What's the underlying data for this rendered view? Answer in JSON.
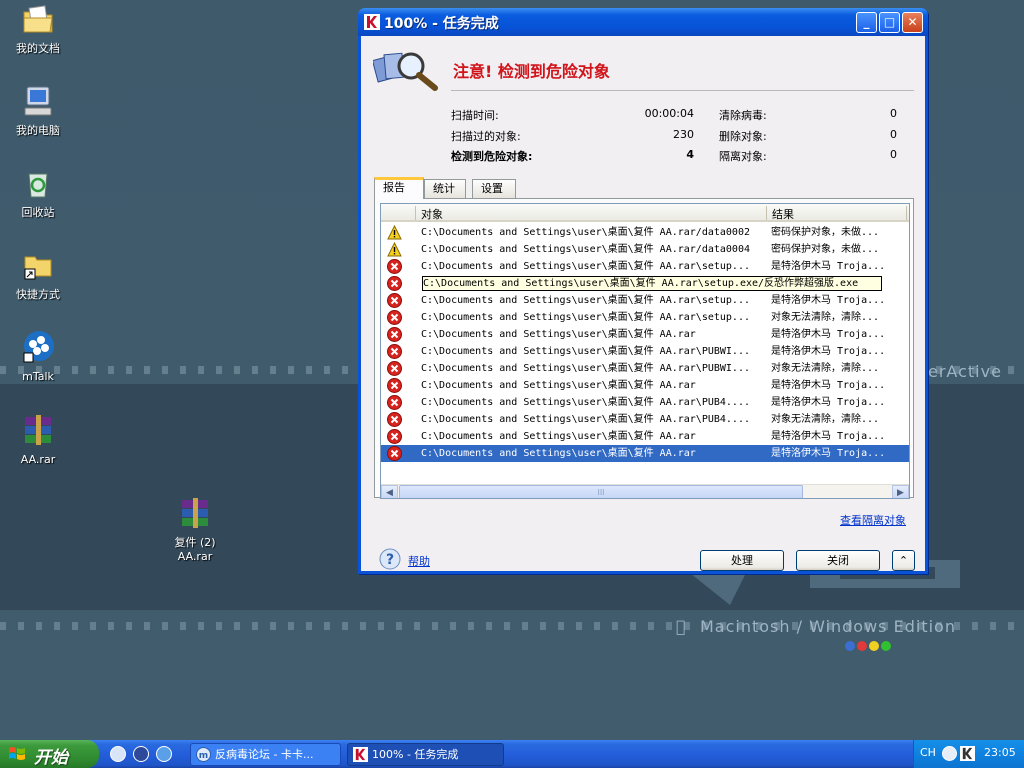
{
  "desktop": {
    "icons": [
      {
        "label": "我的文档"
      },
      {
        "label": "我的电脑"
      },
      {
        "label": "回收站"
      },
      {
        "label": "快捷方式"
      },
      {
        "label": "mTalk"
      },
      {
        "label": "AA.rar"
      },
      {
        "label": "复件 (2)",
        "label2": "AA.rar"
      }
    ],
    "wallpaper_text": "Macintosh / Windows Edition",
    "wallpaper_text2": "erActive"
  },
  "window": {
    "title": "100% - 任务完成",
    "minimize": "_",
    "maximize": "□",
    "close": "✕",
    "alert_title": "注意! 检测到危险对象",
    "stats": {
      "scan_time_label": "扫描时间:",
      "scan_time": "00:00:04",
      "scanned_label": "扫描过的对象:",
      "scanned": "230",
      "detected_label": "检测到危险对象:",
      "detected": "4",
      "disinfected_label": "清除病毒:",
      "disinfected": "0",
      "deleted_label": "删除对象:",
      "deleted": "0",
      "quarantined_label": "隔离对象:",
      "quarantined": "0"
    },
    "tabs": [
      {
        "label": "报告",
        "active": true
      },
      {
        "label": "统计",
        "active": false
      },
      {
        "label": "设置",
        "active": false
      }
    ],
    "columns": {
      "object": "对象",
      "result": "结果"
    },
    "rows": [
      {
        "icon": "warning",
        "object": "C:\\Documents and Settings\\user\\桌面\\复件 AA.rar/data0002",
        "result": "密码保护对象，未做..."
      },
      {
        "icon": "warning",
        "object": "C:\\Documents and Settings\\user\\桌面\\复件 AA.rar/data0004",
        "result": "密码保护对象，未做..."
      },
      {
        "icon": "danger",
        "object": "C:\\Documents and Settings\\user\\桌面\\复件 AA.rar\\setup...",
        "result": "是特洛伊木马 Troja..."
      },
      {
        "icon": "danger",
        "object": "C:\\Documents and Settings\\user\\桌面\\复件 AA.rar\\setup.exe/反恐作弊超强版.exe",
        "result": "...",
        "focus": true
      },
      {
        "icon": "danger",
        "object": "C:\\Documents and Settings\\user\\桌面\\复件 AA.rar\\setup...",
        "result": "是特洛伊木马 Troja..."
      },
      {
        "icon": "danger",
        "object": "C:\\Documents and Settings\\user\\桌面\\复件 AA.rar\\setup...",
        "result": "对象无法清除，清除..."
      },
      {
        "icon": "danger",
        "object": "C:\\Documents and Settings\\user\\桌面\\复件 AA.rar",
        "result": "是特洛伊木马 Troja..."
      },
      {
        "icon": "danger",
        "object": "C:\\Documents and Settings\\user\\桌面\\复件 AA.rar\\PUBWI...",
        "result": "是特洛伊木马 Troja..."
      },
      {
        "icon": "danger",
        "object": "C:\\Documents and Settings\\user\\桌面\\复件 AA.rar\\PUBWI...",
        "result": "对象无法清除，清除..."
      },
      {
        "icon": "danger",
        "object": "C:\\Documents and Settings\\user\\桌面\\复件 AA.rar",
        "result": "是特洛伊木马 Troja..."
      },
      {
        "icon": "danger",
        "object": "C:\\Documents and Settings\\user\\桌面\\复件 AA.rar\\PUB4....",
        "result": "是特洛伊木马 Troja..."
      },
      {
        "icon": "danger",
        "object": "C:\\Documents and Settings\\user\\桌面\\复件 AA.rar\\PUB4....",
        "result": "对象无法清除，清除..."
      },
      {
        "icon": "danger",
        "object": "C:\\Documents and Settings\\user\\桌面\\复件 AA.rar",
        "result": "是特洛伊木马 Troja..."
      },
      {
        "icon": "danger",
        "object": "C:\\Documents and Settings\\user\\桌面\\复件 AA.rar",
        "result": "是特洛伊木马 Troja...",
        "selected": true
      }
    ],
    "scroll_grip": "III",
    "quarantine_link": "查看隔离对象",
    "help_link": "帮助",
    "process_button": "处理",
    "close_button": "关闭",
    "collapse_button": "⌃"
  },
  "taskbar": {
    "start_label": "开始",
    "tasks": [
      {
        "label": "反病毒论坛 - 卡卡...",
        "active": false
      },
      {
        "label": "100% - 任务完成",
        "active": true
      }
    ],
    "lang": "CH",
    "clock": "23:05"
  },
  "colors": {
    "alert_red": "#d0141a",
    "xp_blue": "#0a53d6",
    "selection": "#316ac5"
  }
}
